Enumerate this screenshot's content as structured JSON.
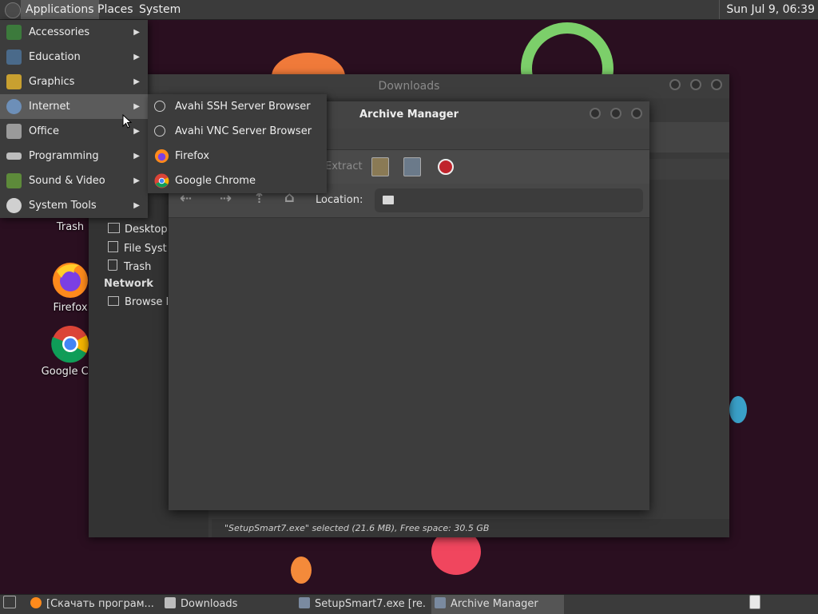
{
  "top_panel": {
    "applications": "Applications",
    "places": "Places",
    "system": "System",
    "clock": "Sun Jul  9, 06:39"
  },
  "apps_menu": [
    {
      "label": "Accessories",
      "icon": "accessories-icon"
    },
    {
      "label": "Education",
      "icon": "education-icon"
    },
    {
      "label": "Graphics",
      "icon": "graphics-icon"
    },
    {
      "label": "Internet",
      "icon": "internet-icon"
    },
    {
      "label": "Office",
      "icon": "office-icon"
    },
    {
      "label": "Programming",
      "icon": "programming-icon"
    },
    {
      "label": "Sound & Video",
      "icon": "sound-video-icon"
    },
    {
      "label": "System Tools",
      "icon": "system-tools-icon"
    }
  ],
  "internet_menu": [
    {
      "label": "Avahi SSH Server Browser"
    },
    {
      "label": "Avahi VNC Server Browser"
    },
    {
      "label": "Firefox"
    },
    {
      "label": "Google Chrome"
    }
  ],
  "desktop": {
    "trash": "Trash",
    "firefox": "Firefox",
    "chrome": "Google Chr"
  },
  "downloads": {
    "title": "Downloads",
    "sidebar": {
      "desktop": "Desktop",
      "filesystem": "File Syst",
      "trash": "Trash",
      "network_head": "Network",
      "browse": "Browse I"
    },
    "status": "\"SetupSmart7.exe\" selected (21.6 MB), Free space: 30.5 GB"
  },
  "archive": {
    "title": "Archive Manager",
    "extract": "Extract",
    "location_label": "Location:"
  },
  "taskbar": [
    {
      "label": "[Скачать програм..."
    },
    {
      "label": "Downloads"
    },
    {
      "label": "SetupSmart7.exe [re..."
    },
    {
      "label": "Archive Manager"
    }
  ],
  "colors": {
    "desktop_bg": "#2a0f20",
    "panel": "#3b3b3b",
    "menu": "#3c3c3c",
    "highlight": "#5b5b5b"
  }
}
